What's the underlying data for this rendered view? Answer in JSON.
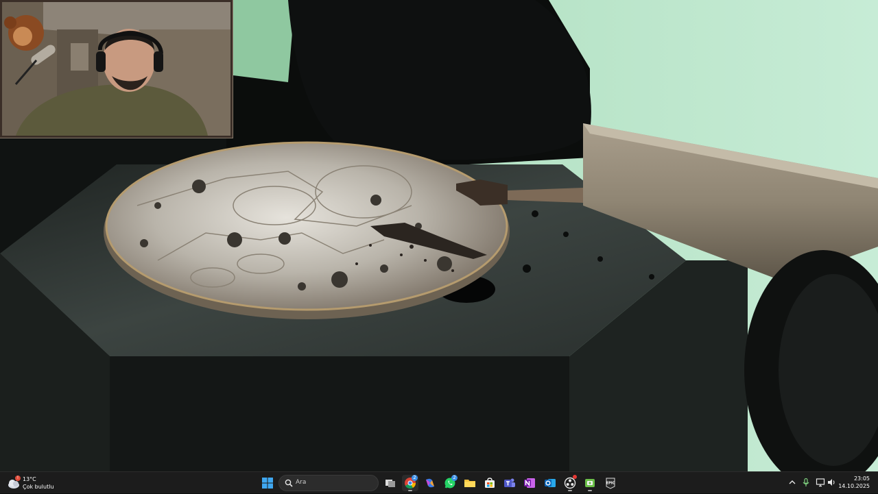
{
  "video": {
    "description_icon": "video-frame"
  },
  "taskbar": {
    "weather": {
      "temp": "13°C",
      "condition": "Çok bulutlu",
      "alert_badge": "!"
    },
    "search": {
      "placeholder": "Ara"
    },
    "apps": [
      {
        "name": "task-view",
        "badge": ""
      },
      {
        "name": "chrome",
        "badge": "2"
      },
      {
        "name": "copilot",
        "badge": ""
      },
      {
        "name": "whatsapp",
        "badge": "2"
      },
      {
        "name": "file-explorer",
        "badge": ""
      },
      {
        "name": "microsoft-store",
        "badge": ""
      },
      {
        "name": "teams",
        "badge": ""
      },
      {
        "name": "onenote",
        "badge": ""
      },
      {
        "name": "outlook",
        "badge": ""
      },
      {
        "name": "obs",
        "badge": ""
      },
      {
        "name": "xbox",
        "badge": ""
      },
      {
        "name": "epic-games",
        "badge": ""
      }
    ],
    "clock": {
      "time": "23:05",
      "date": "14.10.2025"
    }
  }
}
